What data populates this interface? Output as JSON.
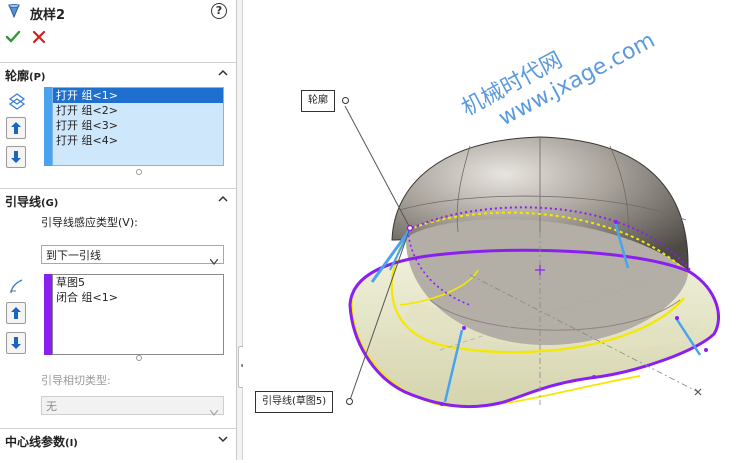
{
  "feature": {
    "title": "放样2",
    "help": "?"
  },
  "profiles": {
    "header_label": "轮廓",
    "header_key": "(P)",
    "items": [
      "打开 组<1>",
      "打开 组<2>",
      "打开 组<3>",
      "打开 组<4>"
    ],
    "selected_index": 0,
    "accent_color": "#4aa3ef"
  },
  "guides": {
    "header_label": "引导线",
    "header_key": "(G)",
    "influence_label": "引导线感应类型(V):",
    "influence_value": "到下一引线",
    "items": [
      "草图5",
      "闭合 组<1>"
    ],
    "accent_color": "#8b1ff0",
    "tangency_label": "引导相切类型:",
    "tangency_value": "无"
  },
  "centerline": {
    "header_label": "中心线参数",
    "header_key": "(I)"
  },
  "viewport": {
    "callout_profile": "轮廓",
    "callout_guide": "引导线(草图5)",
    "watermark_cn": "机械时代网",
    "watermark_url": "www.jxage.com"
  }
}
